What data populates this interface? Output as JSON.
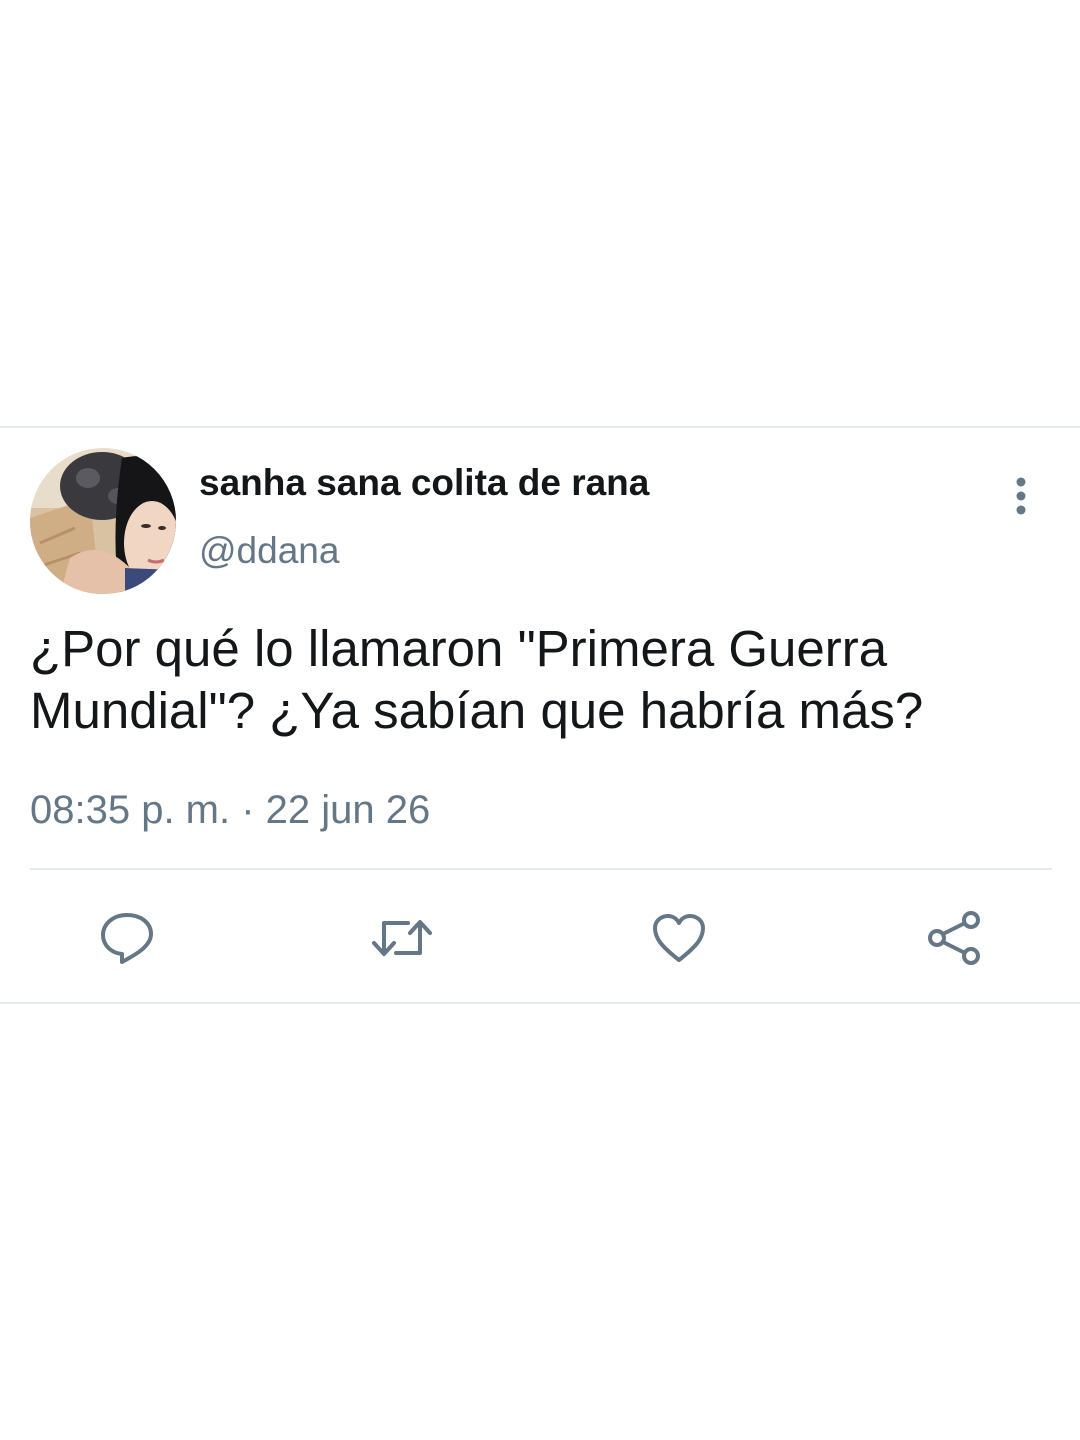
{
  "tweet": {
    "display_name": "sanha sana colita de rana",
    "handle": "@ddana",
    "text": "¿Por qué lo llamaron \"Primera Guerra Mundial\"? ¿Ya sabían que habría más?",
    "timestamp": "08:35 p. m. · 22 jun 26"
  },
  "icons": {
    "more": "more-vertical-icon",
    "reply": "reply-icon",
    "retweet": "retweet-icon",
    "like": "heart-icon",
    "share": "share-icon"
  },
  "colors": {
    "text_primary": "#14171a",
    "text_secondary": "#657786",
    "divider": "#e6e9ec",
    "background": "#ffffff"
  }
}
